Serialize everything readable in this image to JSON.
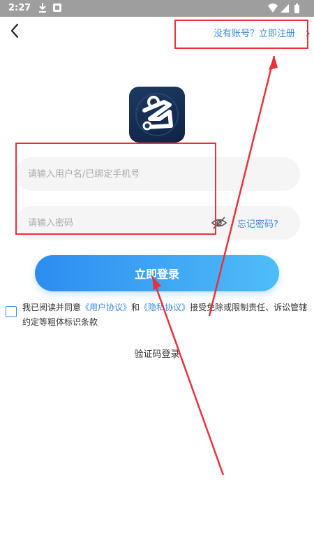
{
  "status_bar": {
    "time": "2:27"
  },
  "header": {
    "register_link": "没有账号？立即注册"
  },
  "form": {
    "username_placeholder": "请输入用户名/已绑定手机号",
    "password_placeholder": "请输入密码",
    "forgot_password": "忘记密码?",
    "login_button": "立即登录"
  },
  "agreement": {
    "prefix": "我已阅读并同意",
    "user_agreement": "《用户协议》",
    "and": "和",
    "privacy_agreement": "《隐私协议》",
    "suffix": "接受免除或限制责任、诉讼管辖约定等粗体标识条款"
  },
  "alt_login": {
    "sms_login": "验证码登录"
  },
  "colors": {
    "accent": "#3b8be0",
    "button_gradient_start": "#2d8cf0",
    "button_gradient_end": "#4fbdf8",
    "annotation_red": "#e8323b",
    "logo_bg": "#1d3a62"
  },
  "icons": {
    "back": "back-arrow-icon",
    "download": "download-icon",
    "notification": "notification-icon",
    "wifi": "wifi-icon",
    "signal": "signal-icon",
    "battery": "battery-icon",
    "eye": "eye-closed-icon",
    "register_chevron": "chevron-right-icon"
  }
}
